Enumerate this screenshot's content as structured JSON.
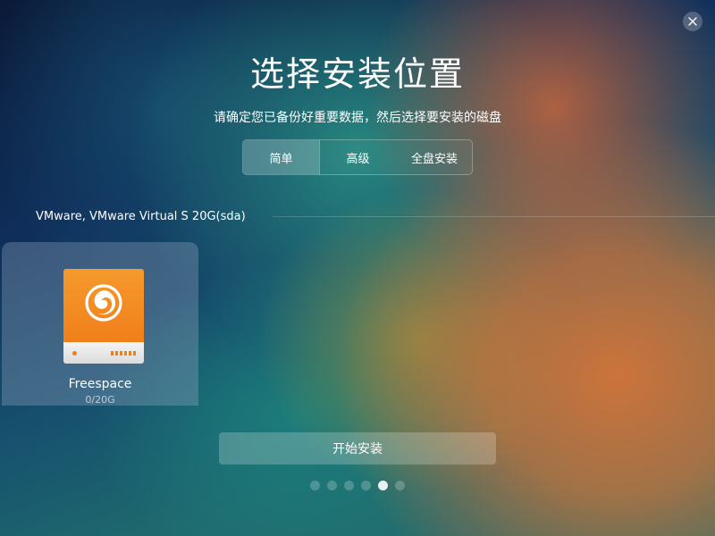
{
  "window": {
    "close_icon": "close-icon"
  },
  "header": {
    "title": "选择安装位置",
    "subtitle": "请确定您已备份好重要数据，然后选择要安装的磁盘"
  },
  "mode_tabs": [
    {
      "label": "简单",
      "selected": true
    },
    {
      "label": "高级",
      "selected": false
    },
    {
      "label": "全盘安装",
      "selected": false
    }
  ],
  "disk": {
    "label": "VMware, VMware Virtual S 20G(sda)"
  },
  "partitions": [
    {
      "name": "Freespace",
      "size": "0/20G",
      "icon": "deepin-drive-icon",
      "color": "#f07f1a"
    }
  ],
  "actions": {
    "start_label": "开始安装"
  },
  "progress": {
    "total_steps": 6,
    "current_step": 5
  },
  "colors": {
    "accent": "#f07f1a"
  }
}
